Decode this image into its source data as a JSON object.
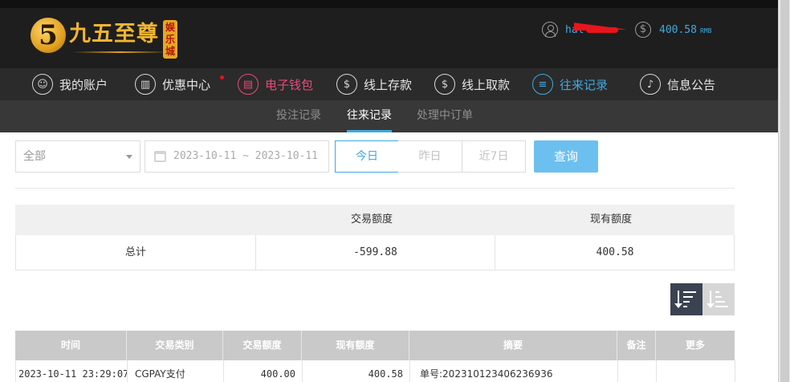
{
  "brand": {
    "mark": "5",
    "name": "九五至尊",
    "stamp": "娱乐城"
  },
  "account": {
    "username": "hal",
    "balance": "400.58",
    "balance_unit": "RMB"
  },
  "nav": {
    "items": [
      {
        "label": "我的账户",
        "icon": "user-icon"
      },
      {
        "label": "优惠中心",
        "icon": "gift-icon"
      },
      {
        "label": "电子钱包",
        "icon": "wallet-icon"
      },
      {
        "label": "线上存款",
        "icon": "deposit-icon"
      },
      {
        "label": "线上取款",
        "icon": "withdraw-icon"
      },
      {
        "label": "往来记录",
        "icon": "records-icon"
      },
      {
        "label": "信息公告",
        "icon": "bell-icon"
      }
    ],
    "active": "往来记录",
    "highlight": "电子钱包"
  },
  "subnav": {
    "items": [
      "投注记录",
      "往来记录",
      "处理中订单"
    ],
    "active": "往来记录"
  },
  "filters": {
    "type_select": "全部",
    "date_range": "2023-10-11 ~ 2023-10-11",
    "quick_ranges": [
      "今日",
      "昨日",
      "近7日"
    ],
    "active_range": "今日",
    "query_label": "查询"
  },
  "summary": {
    "headers": [
      "",
      "交易额度",
      "现有额度"
    ],
    "row": [
      "总计",
      "-599.88",
      "400.58"
    ]
  },
  "table": {
    "headers": [
      "时间",
      "交易类别",
      "交易额度",
      "现有额度",
      "摘要",
      "备注",
      "更多"
    ],
    "rows": [
      [
        "2023-10-11 23:29:07",
        "CGPAY支付",
        "400.00",
        "400.58",
        "单号:202310123406236936",
        "",
        ""
      ]
    ]
  },
  "colors": {
    "accent": "#3fa9e0",
    "highlight": "#e84a7a",
    "header_bg": "#1e1e1e",
    "nav_bg": "#2b2b2b",
    "query_button": "#6cc0ef"
  }
}
